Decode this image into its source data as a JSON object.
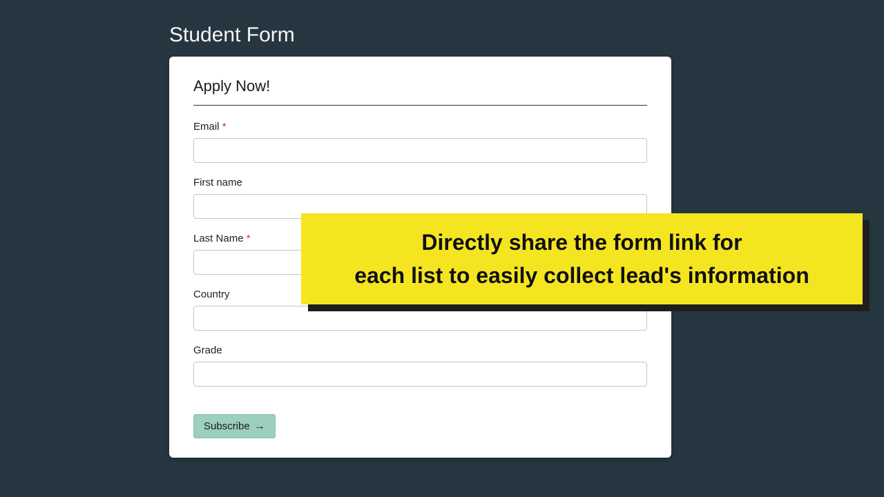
{
  "page": {
    "title": "Student Form"
  },
  "form": {
    "heading": "Apply Now!",
    "fields": {
      "email": {
        "label": "Email",
        "required": "*",
        "value": ""
      },
      "firstName": {
        "label": "First name",
        "value": ""
      },
      "lastName": {
        "label": "Last Name",
        "required": "*",
        "value": ""
      },
      "country": {
        "label": "Country",
        "value": ""
      },
      "grade": {
        "label": "Grade",
        "value": ""
      }
    },
    "submit": {
      "label": "Subscribe"
    }
  },
  "callout": {
    "line1": "Directly share the form link for",
    "line2": "each list to easily collect lead's information"
  }
}
